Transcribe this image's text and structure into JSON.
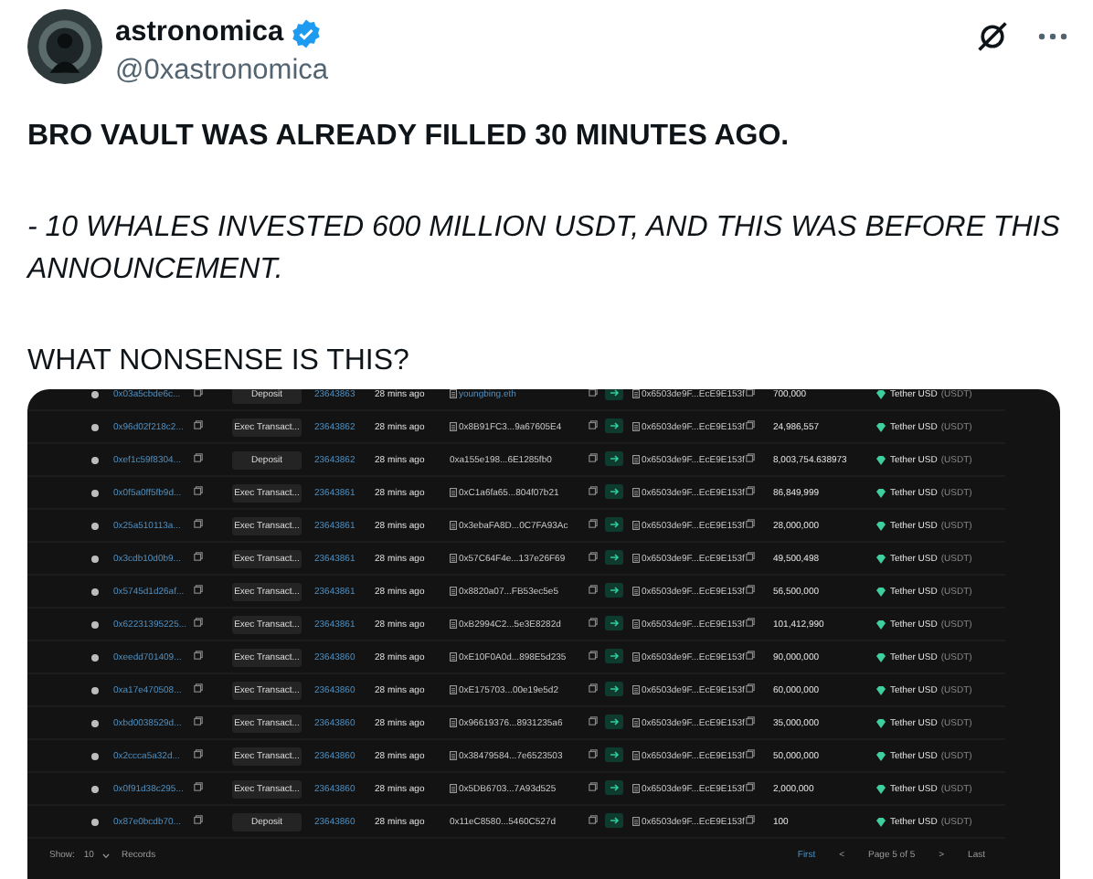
{
  "author": {
    "name": "astronomica",
    "handle": "@0xastronomica",
    "verified": true
  },
  "paragraphs": [
    {
      "kind": "bold",
      "text": "BRO VAULT WAS ALREADY FILLED 30 MINUTES AGO."
    },
    {
      "kind": "italic",
      "text": "- 10 WHALES INVESTED 600 MILLION USDT, AND THIS WAS BEFORE THIS ANNOUNCEMENT."
    },
    {
      "kind": "plain",
      "text": "WHAT NONSENSE IS THIS?"
    }
  ],
  "transactions": {
    "rows": [
      {
        "hash": "0x03a5cbde6c...",
        "method": "Deposit",
        "block": "23643863",
        "age": "28 mins ago",
        "from": "youngbing.eth",
        "from_contract": true,
        "to": "0x6503de9F...EcE9E153f",
        "amount": "700,000",
        "token": "Tether USD",
        "symbol": "(USDT)"
      },
      {
        "hash": "0x96d02f218c2...",
        "method": "Exec Transact...",
        "block": "23643862",
        "age": "28 mins ago",
        "from": "0x8B91FC3...9a67605E4",
        "from_contract": true,
        "to": "0x6503de9F...EcE9E153f",
        "amount": "24,986,557",
        "token": "Tether USD",
        "symbol": "(USDT)"
      },
      {
        "hash": "0xef1c59f8304...",
        "method": "Deposit",
        "block": "23643862",
        "age": "28 mins ago",
        "from": "0xa155e198...6E1285fb0",
        "from_contract": false,
        "to": "0x6503de9F...EcE9E153f",
        "amount": "8,003,754.638973",
        "token": "Tether USD",
        "symbol": "(USDT)"
      },
      {
        "hash": "0x0f5a0ff5fb9d...",
        "method": "Exec Transact...",
        "block": "23643861",
        "age": "28 mins ago",
        "from": "0xC1a6fa65...804f07b21",
        "from_contract": true,
        "to": "0x6503de9F...EcE9E153f",
        "amount": "86,849,999",
        "token": "Tether USD",
        "symbol": "(USDT)"
      },
      {
        "hash": "0x25a510113a...",
        "method": "Exec Transact...",
        "block": "23643861",
        "age": "28 mins ago",
        "from": "0x3ebaFA8D...0C7FA93Ac",
        "from_contract": true,
        "to": "0x6503de9F...EcE9E153f",
        "amount": "28,000,000",
        "token": "Tether USD",
        "symbol": "(USDT)"
      },
      {
        "hash": "0x3cdb10d0b9...",
        "method": "Exec Transact...",
        "block": "23643861",
        "age": "28 mins ago",
        "from": "0x57C64F4e...137e26F69",
        "from_contract": true,
        "to": "0x6503de9F...EcE9E153f",
        "amount": "49,500,498",
        "token": "Tether USD",
        "symbol": "(USDT)"
      },
      {
        "hash": "0x5745d1d26af...",
        "method": "Exec Transact...",
        "block": "23643861",
        "age": "28 mins ago",
        "from": "0x8820a07...FB53ec5e5",
        "from_contract": true,
        "to": "0x6503de9F...EcE9E153f",
        "amount": "56,500,000",
        "token": "Tether USD",
        "symbol": "(USDT)"
      },
      {
        "hash": "0x62231395225...",
        "method": "Exec Transact...",
        "block": "23643861",
        "age": "28 mins ago",
        "from": "0xB2994C2...5e3E8282d",
        "from_contract": true,
        "to": "0x6503de9F...EcE9E153f",
        "amount": "101,412,990",
        "token": "Tether USD",
        "symbol": "(USDT)"
      },
      {
        "hash": "0xeedd701409...",
        "method": "Exec Transact...",
        "block": "23643860",
        "age": "28 mins ago",
        "from": "0xE10F0A0d...898E5d235",
        "from_contract": true,
        "to": "0x6503de9F...EcE9E153f",
        "amount": "90,000,000",
        "token": "Tether USD",
        "symbol": "(USDT)"
      },
      {
        "hash": "0xa17e470508...",
        "method": "Exec Transact...",
        "block": "23643860",
        "age": "28 mins ago",
        "from": "0xE175703...00e19e5d2",
        "from_contract": true,
        "to": "0x6503de9F...EcE9E153f",
        "amount": "60,000,000",
        "token": "Tether USD",
        "symbol": "(USDT)"
      },
      {
        "hash": "0xbd0038529d...",
        "method": "Exec Transact...",
        "block": "23643860",
        "age": "28 mins ago",
        "from": "0x96619376...8931235a6",
        "from_contract": true,
        "to": "0x6503de9F...EcE9E153f",
        "amount": "35,000,000",
        "token": "Tether USD",
        "symbol": "(USDT)"
      },
      {
        "hash": "0x2ccca5a32d...",
        "method": "Exec Transact...",
        "block": "23643860",
        "age": "28 mins ago",
        "from": "0x38479584...7e6523503",
        "from_contract": true,
        "to": "0x6503de9F...EcE9E153f",
        "amount": "50,000,000",
        "token": "Tether USD",
        "symbol": "(USDT)"
      },
      {
        "hash": "0x0f91d38c295...",
        "method": "Exec Transact...",
        "block": "23643860",
        "age": "28 mins ago",
        "from": "0x5DB6703...7A93d525",
        "from_contract": true,
        "to": "0x6503de9F...EcE9E153f",
        "amount": "2,000,000",
        "token": "Tether USD",
        "symbol": "(USDT)"
      },
      {
        "hash": "0x87e0bcdb70...",
        "method": "Deposit",
        "block": "23643860",
        "age": "28 mins ago",
        "from": "0x11eC8580...5460C527d",
        "from_contract": false,
        "to": "0x6503de9F...EcE9E153f",
        "amount": "100",
        "token": "Tether USD",
        "symbol": "(USDT)"
      }
    ],
    "footer": {
      "show_label": "Show:",
      "page_size": "10",
      "records_label": "Records",
      "first": "First",
      "prev": "<",
      "page": "Page 5 of 5",
      "next": ">",
      "last": "Last"
    }
  }
}
